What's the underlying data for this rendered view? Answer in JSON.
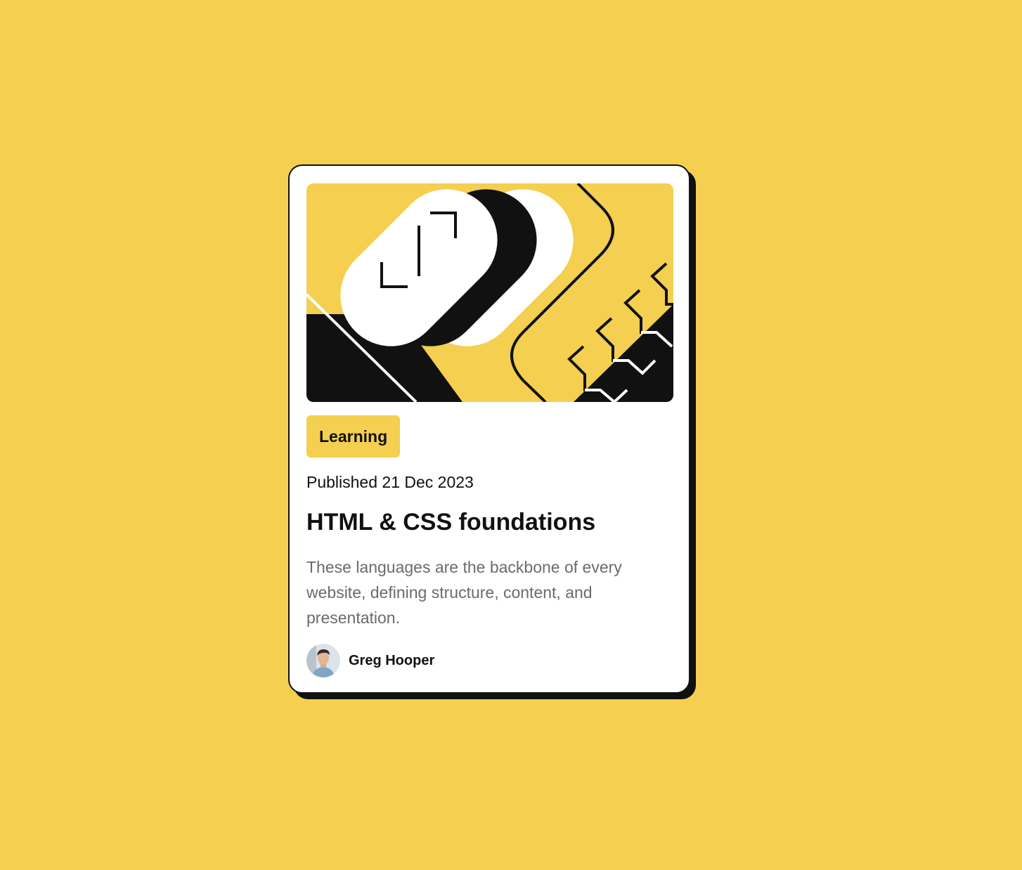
{
  "card": {
    "category": "Learning",
    "published": "Published 21 Dec 2023",
    "title": "HTML & CSS foundations",
    "description": "These languages are the backbone of every website, defining structure, content, and presentation.",
    "author": {
      "name": "Greg Hooper",
      "avatar_icon": "person-avatar"
    },
    "illustration_icon": "abstract-code-illustration"
  },
  "colors": {
    "background": "#F4CF50",
    "card": "#FFFFFF",
    "ink": "#111111",
    "muted_text": "#6B6B6B"
  }
}
